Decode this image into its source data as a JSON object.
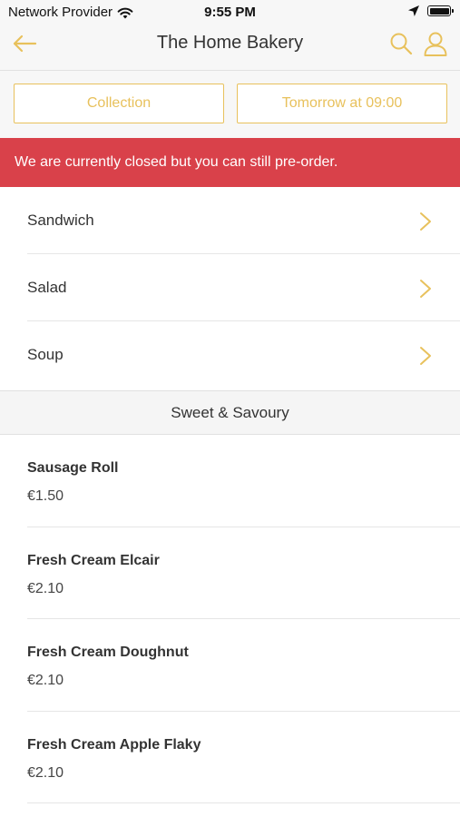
{
  "status_bar": {
    "carrier": "Network Provider",
    "time": "9:55 PM",
    "icons": [
      "wifi-icon",
      "location-arrow-icon",
      "battery-icon"
    ]
  },
  "nav": {
    "title": "The Home Bakery",
    "icons": [
      "back-arrow-icon",
      "search-icon",
      "user-icon"
    ],
    "accent_color": "#e8c15c"
  },
  "order_options": {
    "collection_label": "Collection",
    "time_label": "Tomorrow at 09:00"
  },
  "banner": {
    "message": "We are currently closed but you can still pre-order.",
    "color": "#d9414a"
  },
  "categories": [
    {
      "label": "Sandwich"
    },
    {
      "label": "Salad"
    },
    {
      "label": "Soup"
    }
  ],
  "section": {
    "title": "Sweet & Savoury"
  },
  "products": [
    {
      "name": "Sausage Roll",
      "price": "€1.50"
    },
    {
      "name": "Fresh Cream Elcair",
      "price": "€2.10"
    },
    {
      "name": "Fresh Cream Doughnut",
      "price": "€2.10"
    },
    {
      "name": "Fresh Cream Apple Flaky",
      "price": "€2.10"
    }
  ]
}
